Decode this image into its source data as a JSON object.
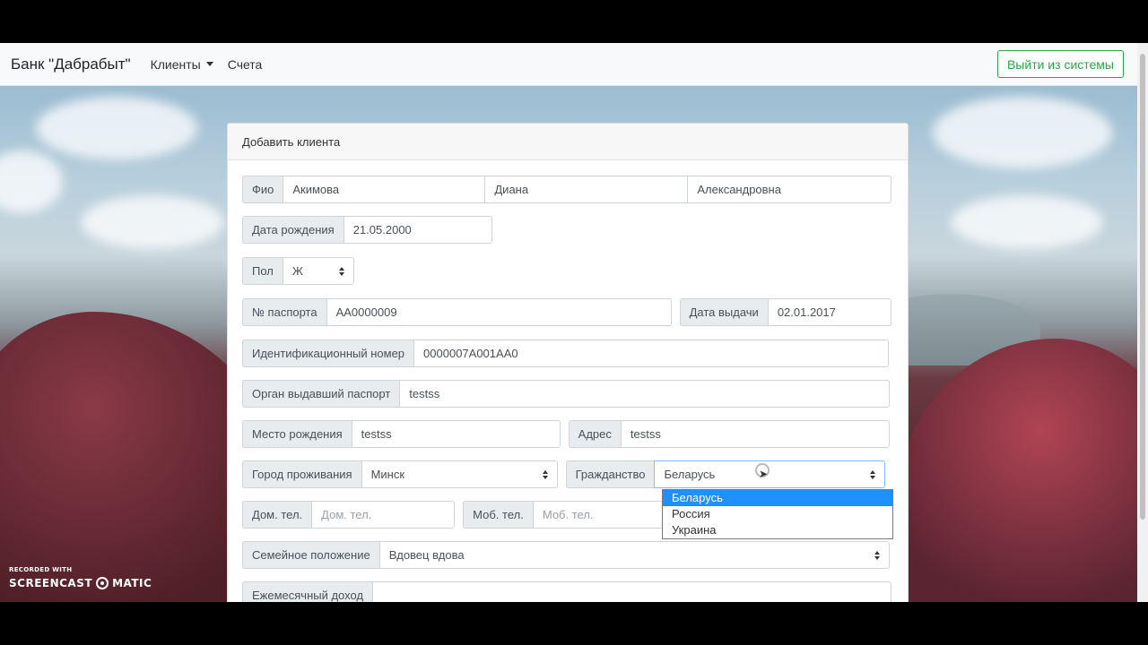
{
  "navbar": {
    "brand": "Банк \"Дабрабыт\"",
    "menu_clients": "Клиенты",
    "menu_accounts": "Счета",
    "logout": "Выйти из системы"
  },
  "form": {
    "title": "Добавить клиента",
    "fio_label": "Фио",
    "last_name": "Акимова",
    "first_name": "Диана",
    "middle_name": "Александровна",
    "birth_date_label": "Дата рождения",
    "birth_date": "21.05.2000",
    "gender_label": "Пол",
    "gender": "Ж",
    "passport_label": "№ паспорта",
    "passport": "AA0000009",
    "issue_date_label": "Дата выдачи",
    "issue_date": "02.01.2017",
    "id_number_label": "Идентификационный номер",
    "id_number": "0000007A001AA0",
    "issuer_label": "Орган выдавший паспорт",
    "issuer": "testss",
    "birth_place_label": "Место рождения",
    "birth_place": "testss",
    "address_label": "Адрес",
    "address": "testss",
    "city_label": "Город проживания",
    "city": "Минск",
    "citizenship_label": "Гражданство",
    "citizenship": "Беларусь",
    "citizenship_options": [
      "Беларусь",
      "Россия",
      "Украина"
    ],
    "home_phone_label": "Дом. тел.",
    "home_phone_placeholder": "Дом. тел.",
    "mobile_phone_label": "Моб. тел.",
    "mobile_phone_placeholder": "Моб. тел.",
    "marital_label": "Семейное положение",
    "marital": "Вдовец вдова",
    "income_label": "Ежемесячный доход"
  },
  "watermark": {
    "line1": "RECORDED WITH",
    "brand_left": "SCREENCAST",
    "brand_right": "MATIC"
  }
}
